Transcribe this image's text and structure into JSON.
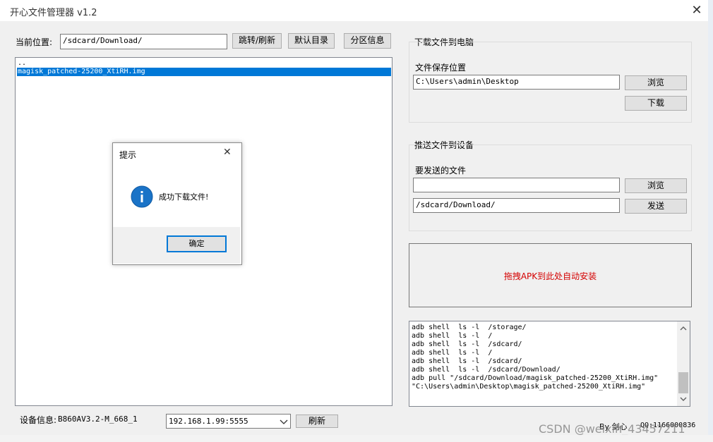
{
  "window": {
    "title": "开心文件管理器  v1.2",
    "close_glyph": "✕"
  },
  "path_bar": {
    "label": "当前位置:",
    "value": "/sdcard/Download/",
    "go_refresh_button": "跳转/刷新",
    "default_dir_button": "默认目录",
    "partition_info_button": "分区信息"
  },
  "file_list": {
    "items": [
      {
        "name": "..",
        "selected": false
      },
      {
        "name": "magisk_patched-25200_XtiRH.img",
        "selected": true
      }
    ]
  },
  "download_section": {
    "title": "下载文件到电脑",
    "save_location_label": "文件保存位置",
    "save_path": "C:\\Users\\admin\\Desktop",
    "browse_button": "浏览",
    "download_button": "下载"
  },
  "push_section": {
    "title": "推送文件到设备",
    "file_to_send_label": "要发送的文件",
    "file_to_send_value": "",
    "browse_button": "浏览",
    "target_path": "/sdcard/Download/",
    "send_button": "发送"
  },
  "drop_zone": {
    "text": "拖拽APK到此处自动安装",
    "text_color": "#d40000"
  },
  "log": {
    "lines": [
      "adb shell  ls -l  /storage/",
      "adb shell  ls -l  /",
      "adb shell  ls -l  /sdcard/",
      "adb shell  ls -l  /",
      "adb shell  ls -l  /sdcard/",
      "adb shell  ls -l  /sdcard/Download/",
      "adb pull \"/sdcard/Download/magisk_patched-25200_XtiRH.img\"",
      "\"C:\\Users\\admin\\Desktop\\magisk_patched-25200_XtiRH.img\""
    ]
  },
  "footer": {
    "device_info_label": "设备信息:",
    "device_info_value": "B860AV3.2-M_668_1",
    "address": "192.168.1.99:5555",
    "refresh_button": "刷新",
    "author": "By 剑心",
    "qq": "QQ:1166000836",
    "watermark": "CSDN @weixin_43457211"
  },
  "dialog": {
    "title": "提示",
    "message": "成功下载文件!",
    "ok_button": "确定",
    "close_glyph": "✕",
    "info_icon_glyph": "i",
    "info_icon_color": "#1a73c7"
  },
  "colors": {
    "selection": "#0078d7",
    "window_bg": "#f0f0f0"
  }
}
